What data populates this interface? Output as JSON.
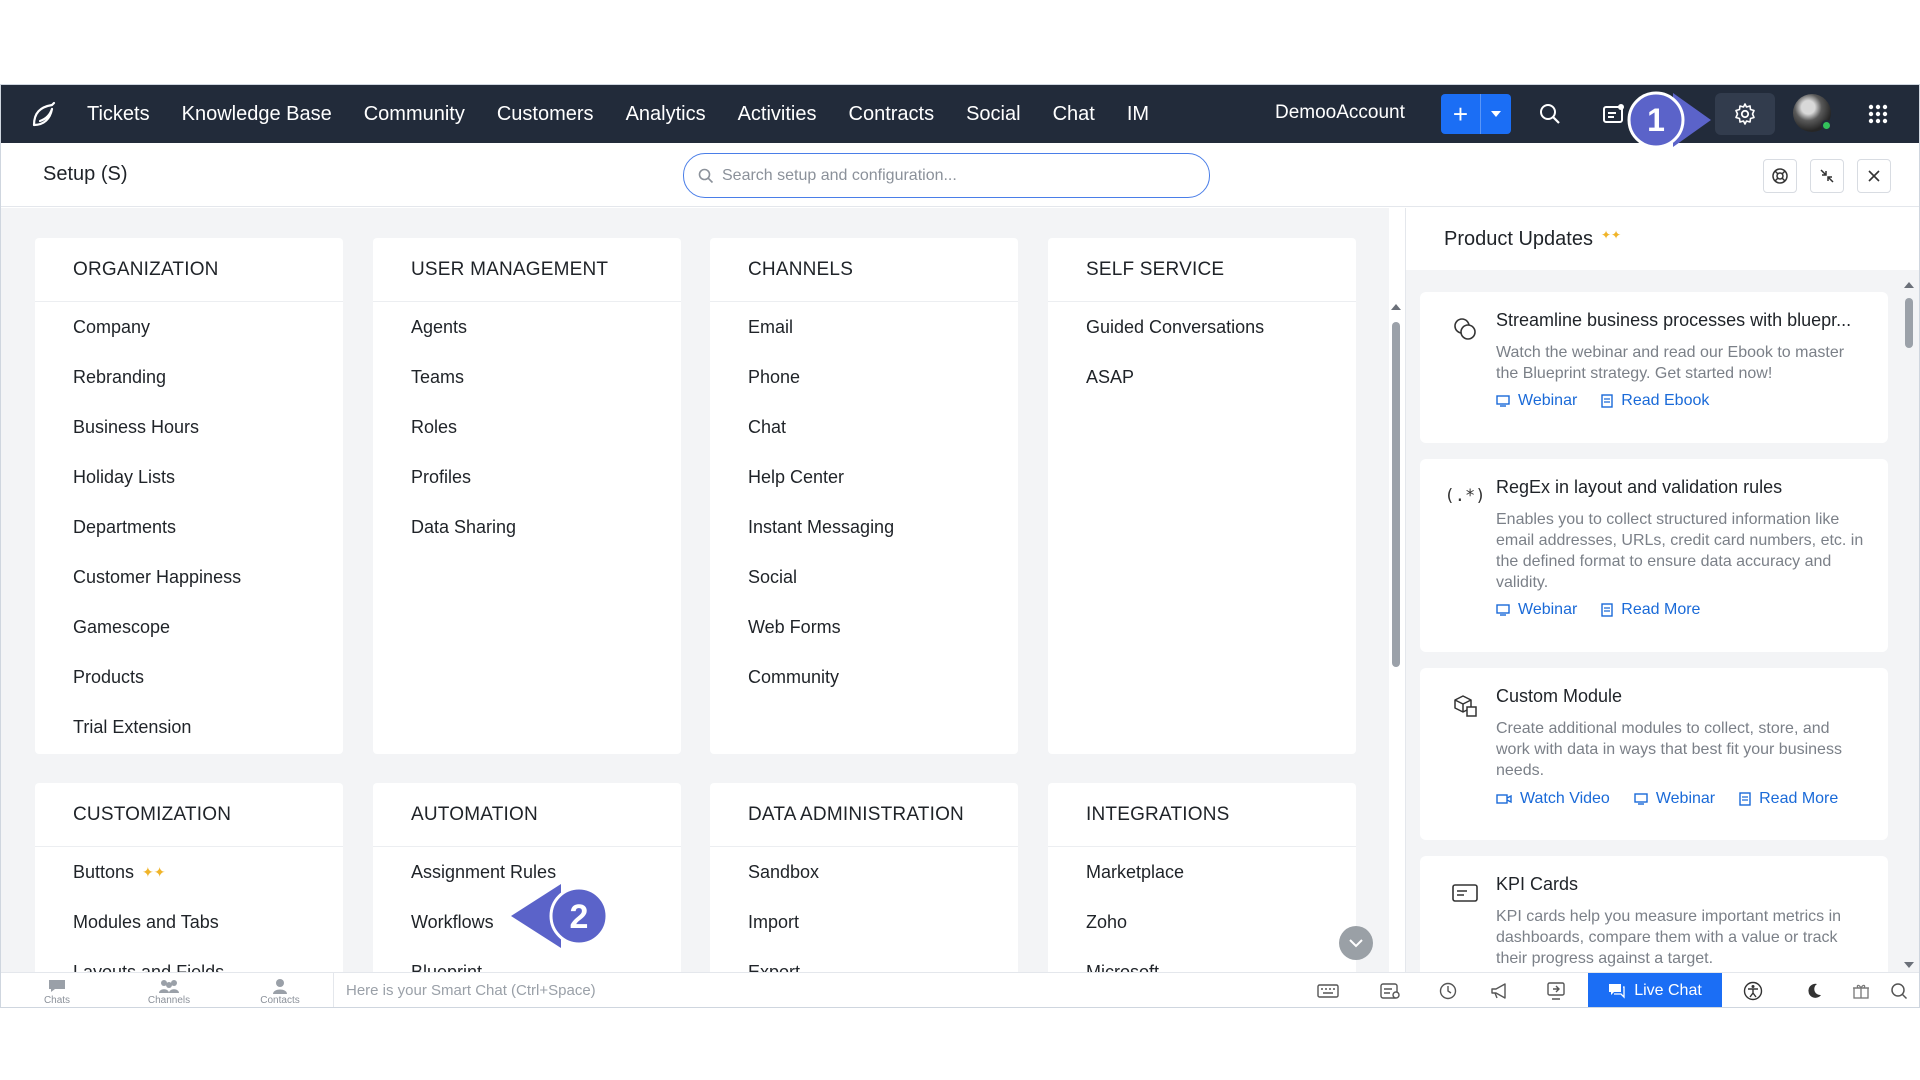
{
  "topnav": {
    "items": [
      "Tickets",
      "Knowledge Base",
      "Community",
      "Customers",
      "Analytics",
      "Activities",
      "Contracts",
      "Social",
      "Chat",
      "IM"
    ],
    "account": "DemooAccount"
  },
  "setup": {
    "title": "Setup (S)",
    "search_placeholder": "Search setup and configuration..."
  },
  "sections": {
    "organization": {
      "title": "ORGANIZATION",
      "items": [
        "Company",
        "Rebranding",
        "Business Hours",
        "Holiday Lists",
        "Departments",
        "Customer Happiness",
        "Gamescope",
        "Products",
        "Trial Extension"
      ]
    },
    "user_management": {
      "title": "USER MANAGEMENT",
      "items": [
        "Agents",
        "Teams",
        "Roles",
        "Profiles",
        "Data Sharing"
      ]
    },
    "channels": {
      "title": "CHANNELS",
      "items": [
        "Email",
        "Phone",
        "Chat",
        "Help Center",
        "Instant Messaging",
        "Social",
        "Web Forms",
        "Community"
      ]
    },
    "self_service": {
      "title": "SELF SERVICE",
      "items": [
        "Guided Conversations",
        "ASAP"
      ]
    },
    "customization": {
      "title": "CUSTOMIZATION",
      "items": [
        "Buttons",
        "Modules and Tabs",
        "Layouts and Fields"
      ]
    },
    "automation": {
      "title": "AUTOMATION",
      "items": [
        "Assignment Rules",
        "Workflows",
        "Blueprint"
      ]
    },
    "data_administration": {
      "title": "DATA ADMINISTRATION",
      "items": [
        "Sandbox",
        "Import",
        "Export"
      ]
    },
    "integrations": {
      "title": "INTEGRATIONS",
      "items": [
        "Marketplace",
        "Zoho",
        "Microsoft"
      ]
    }
  },
  "updates": {
    "title": "Product Updates",
    "cards": [
      {
        "title": "Streamline business processes with bluepr...",
        "desc": "Watch the webinar and read our Ebook to master the Blueprint strategy. Get started now!",
        "links": [
          "Webinar",
          "Read Ebook"
        ],
        "icon": "blueprint-icon"
      },
      {
        "title": "RegEx in layout and validation rules",
        "desc": "Enables you to collect structured information like email addresses, URLs, credit card numbers, etc. in the defined format to ensure data accuracy and validity.",
        "links": [
          "Webinar",
          "Read More"
        ],
        "icon": "regex-icon"
      },
      {
        "title": "Custom Module",
        "desc": "Create additional modules to collect, store, and work with data in ways that best fit your business needs.",
        "links": [
          "Watch Video",
          "Webinar",
          "Read More"
        ],
        "icon": "cube-icon"
      },
      {
        "title": "KPI Cards",
        "desc": "KPI cards help you measure important metrics in dashboards, compare them with a value or track their progress against a target.",
        "links": [],
        "icon": "kpi-card-icon"
      }
    ]
  },
  "bottombar": {
    "chats": "Chats",
    "channels": "Channels",
    "contacts": "Contacts",
    "smartchat_placeholder": "Here is your Smart Chat (Ctrl+Space)",
    "livechat": "Live Chat"
  },
  "annotations": {
    "step1": "1",
    "step2": "2",
    "color": "#5b63c9"
  },
  "colors": {
    "nav_bg": "#222b3a",
    "accent": "#1b6ef5",
    "link": "#1a6ad8"
  }
}
